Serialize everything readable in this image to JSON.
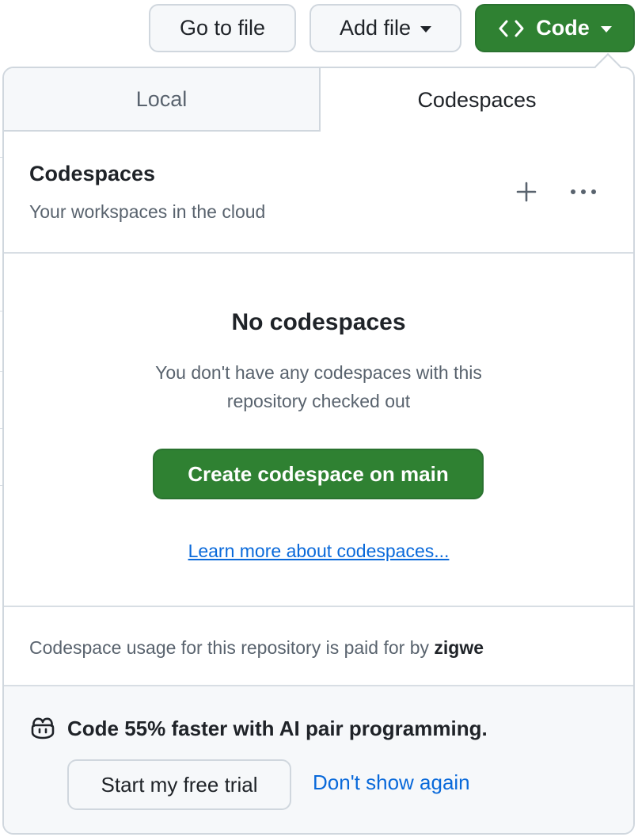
{
  "toolbar": {
    "go_to_file": "Go to file",
    "add_file": "Add file",
    "code": "Code"
  },
  "tabs": {
    "local": "Local",
    "codespaces": "Codespaces"
  },
  "header": {
    "title": "Codespaces",
    "subtitle": "Your workspaces in the cloud"
  },
  "empty_state": {
    "title": "No codespaces",
    "description": "You don't have any codespaces with this repository checked out",
    "create_button": "Create codespace on main",
    "learn_more": "Learn more about codespaces..."
  },
  "usage": {
    "prefix": "Codespace usage for this repository is paid for by ",
    "owner": "zigwe"
  },
  "promo": {
    "text": "Code 55% faster with AI pair programming.",
    "trial_button": "Start my free trial",
    "dismiss": "Don't show again"
  },
  "colors": {
    "primary_green": "#2f8132",
    "link_blue": "#0969da",
    "muted_text": "#59636e"
  }
}
